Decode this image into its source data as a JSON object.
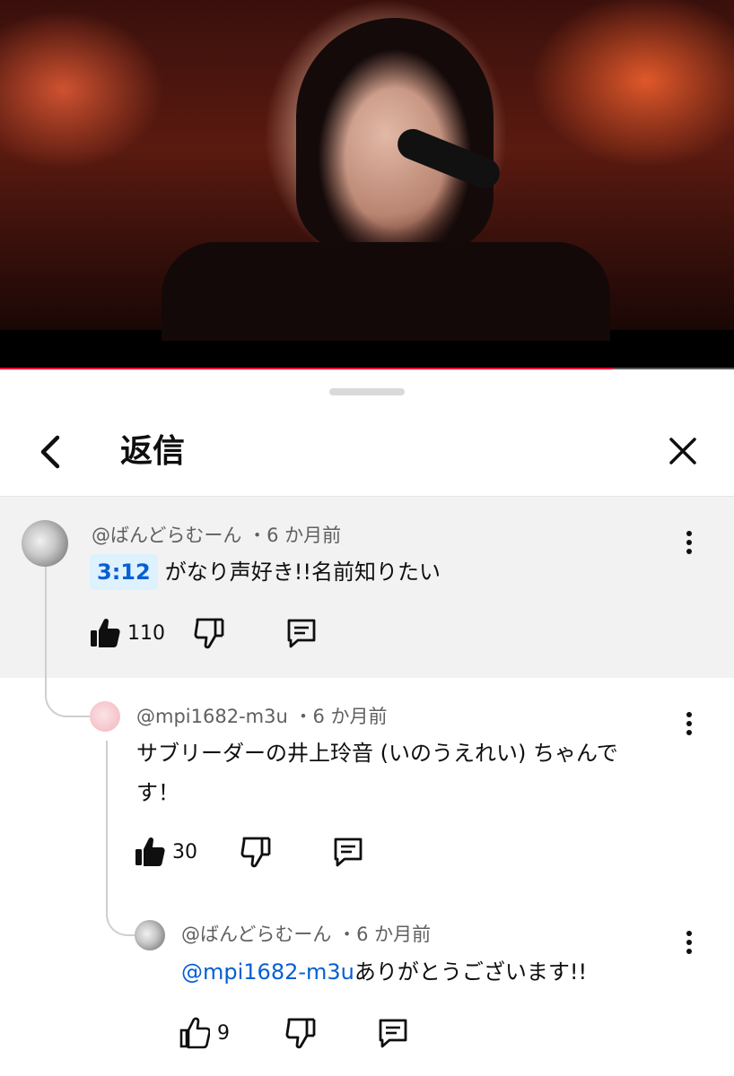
{
  "video": {
    "progress": 0.835,
    "progress_color": "#ff0033"
  },
  "header": {
    "title": "返信",
    "back_icon": "chevron-left-icon",
    "close_icon": "close-icon"
  },
  "comments": [
    {
      "author": "@ばんどらむーん",
      "separator": "・",
      "age": "6 か月前",
      "timestamp_link": "3:12",
      "text": "がなり声好き!!名前知りたい",
      "likes": "110",
      "like_icon": "thumb-up-filled-icon",
      "avatar_color": "#bdbdbd"
    },
    {
      "author": "@mpi1682-m3u",
      "separator": "・",
      "age": "6 か月前",
      "text_line1": "サブリーダーの井上玲音 (いのうえれい) ちゃんで",
      "text_line2": "す！",
      "likes": "30",
      "like_icon": "thumb-up-filled-icon",
      "avatar_color": "#f5c7cd"
    },
    {
      "author": "@ばんどらむーん",
      "separator": "・",
      "age": "6 か月前",
      "mention": "@mpi1682-m3u",
      "text": "ありがとうございます!!",
      "likes": "9",
      "like_icon": "thumb-up-outline-icon",
      "avatar_color": "#bdbdbd"
    }
  ],
  "colors": {
    "link": "#065fd4",
    "chip_bg": "#def1ff",
    "selected_bg": "#f2f2f2",
    "meta_text": "#606060"
  }
}
